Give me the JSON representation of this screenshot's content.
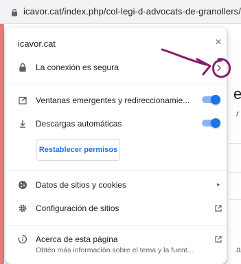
{
  "browser": {
    "url": "icavor.cat/index.php/col-legi-d-advocats-de-granollers/",
    "icons": {
      "secure": "lock-icon"
    }
  },
  "popup": {
    "site": "icavor.cat",
    "close_label": "×",
    "connection": {
      "label": "La conexión es segura",
      "icon": "lock-icon",
      "chevron": "chevron-right-icon"
    },
    "permissions": [
      {
        "label": "Ventanas emergentes y redireccionamie...",
        "icon": "popup-open-icon",
        "enabled": true
      },
      {
        "label": "Descargas automáticas",
        "icon": "download-icon",
        "enabled": true
      }
    ],
    "reset_button": "Restablecer permisos",
    "items": [
      {
        "label": "Datos de sitios y cookies",
        "icon": "cookie-icon",
        "trailing": "▸"
      },
      {
        "label": "Configuración de sitios",
        "icon": "gear-icon",
        "trailing": "external-link-icon"
      },
      {
        "label": "Acerca de esta página",
        "subtitle": "Obtén más información sobre el tema y la fuent...",
        "icon": "about-page-icon",
        "trailing": "external-link-icon"
      }
    ]
  },
  "background_page": {
    "peek_heading": "e",
    "peek_text": "r",
    "peek_bottom": "a"
  },
  "annotation": {
    "color": "#8b1a6b",
    "type": "hand-drawn arrow and circle around chevron"
  },
  "colors": {
    "accent": "#1a73e8",
    "toggle_track": "#8ab4f8",
    "text": "#202124",
    "secondary": "#5f6368"
  }
}
